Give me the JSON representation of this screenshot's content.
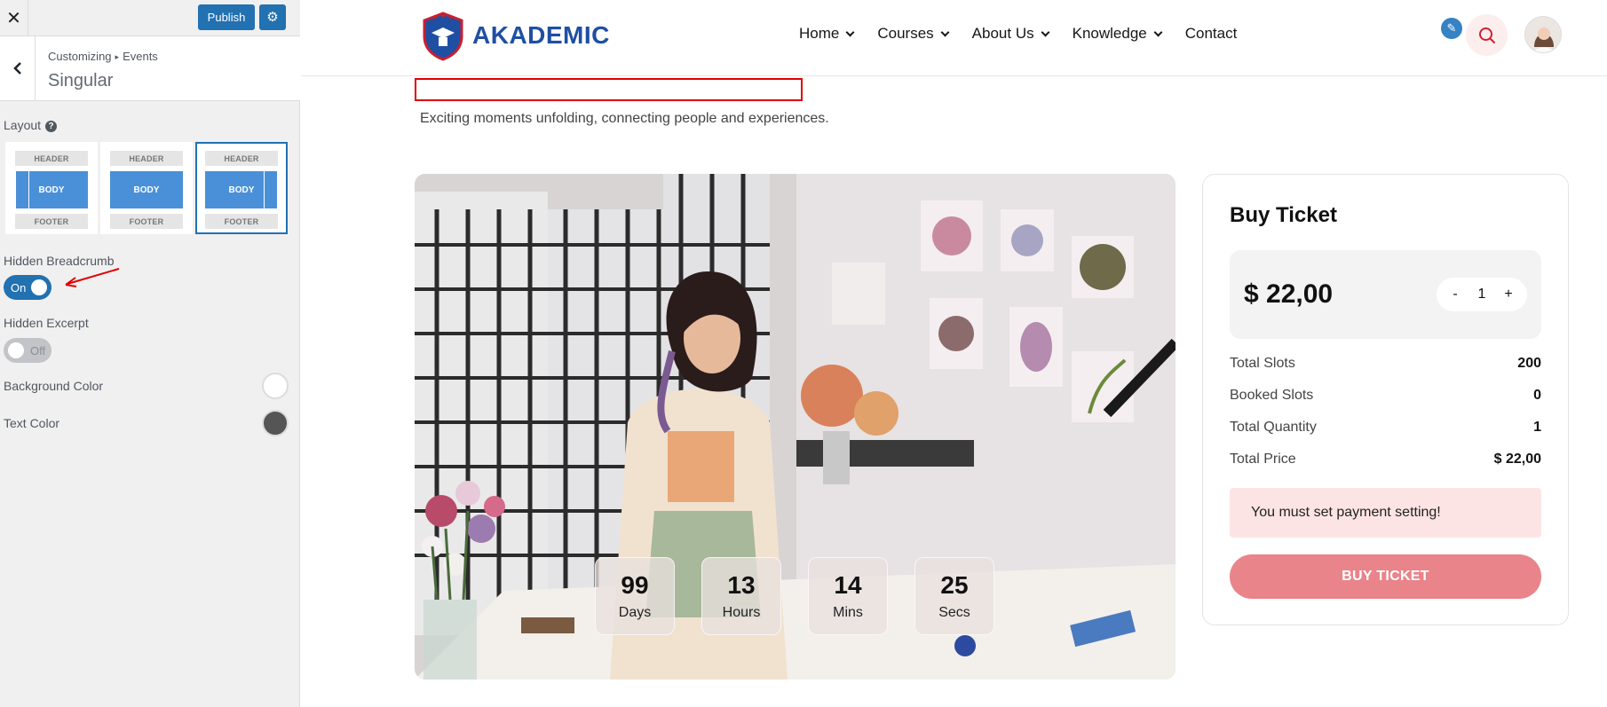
{
  "customizer": {
    "publish_label": "Publish",
    "breadcrumb": [
      "Customizing",
      "Events"
    ],
    "section_title": "Singular",
    "layout_label": "Layout",
    "layout_options": [
      {
        "header": "HEADER",
        "body": "BODY",
        "footer": "FOOTER"
      },
      {
        "header": "HEADER",
        "body": "BODY",
        "footer": "FOOTER"
      },
      {
        "header": "HEADER",
        "body": "BODY",
        "footer": "FOOTER"
      }
    ],
    "hidden_breadcrumb_label": "Hidden Breadcrumb",
    "hidden_breadcrumb_state": "On",
    "hidden_excerpt_label": "Hidden Excerpt",
    "hidden_excerpt_state": "Off",
    "background_color_label": "Background Color",
    "background_color": "#ffffff",
    "text_color_label": "Text Color",
    "text_color": "#555555"
  },
  "site": {
    "logo_text": "AKADEMIC",
    "nav": [
      {
        "label": "Home",
        "dropdown": true
      },
      {
        "label": "Courses",
        "dropdown": true
      },
      {
        "label": "About Us",
        "dropdown": true
      },
      {
        "label": "Knowledge",
        "dropdown": true
      },
      {
        "label": "Contact",
        "dropdown": false
      }
    ],
    "accent_color": "#e8848a",
    "brand_color": "#1e4fa3"
  },
  "event": {
    "excerpt": "Exciting moments unfolding, connecting people and experiences.",
    "countdown": [
      {
        "value": "99",
        "unit": "Days"
      },
      {
        "value": "13",
        "unit": "Hours"
      },
      {
        "value": "14",
        "unit": "Mins"
      },
      {
        "value": "25",
        "unit": "Secs"
      }
    ]
  },
  "ticket": {
    "title": "Buy Ticket",
    "price": "$ 22,00",
    "qty_minus": "-",
    "qty": "1",
    "qty_plus": "+",
    "rows": [
      {
        "label": "Total Slots",
        "value": "200"
      },
      {
        "label": "Booked Slots",
        "value": "0"
      },
      {
        "label": "Total Quantity",
        "value": "1"
      },
      {
        "label": "Total Price",
        "value": "$ 22,00"
      }
    ],
    "alert": "You must set payment setting!",
    "button": "BUY TICKET"
  }
}
